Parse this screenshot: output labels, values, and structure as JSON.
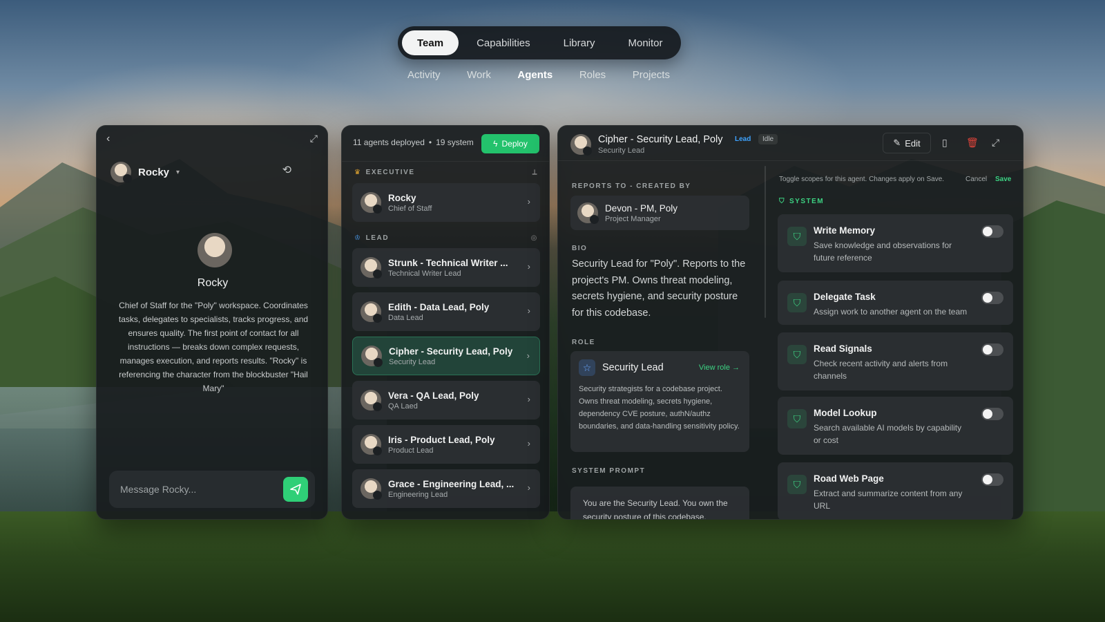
{
  "topnav": {
    "tabs": [
      "Team",
      "Capabilities",
      "Library",
      "Monitor"
    ],
    "active": "Team"
  },
  "subnav": {
    "tabs": [
      "Activity",
      "Work",
      "Agents",
      "Roles",
      "Projects"
    ],
    "active": "Agents"
  },
  "chat": {
    "user": "Rocky",
    "profile_name": "Rocky",
    "description": "Chief of Staff for the \"Poly\" workspace. Coordinates tasks, delegates to specialists, tracks progress, and ensures quality. The first point of contact for all instructions — breaks down complex requests, manages execution, and reports results. \"Rocky\" is referencing the character from the blockbuster \"Hail Mary\"",
    "input_placeholder": "Message Rocky..."
  },
  "agents_panel": {
    "summary_deployed": "11 agents deployed",
    "summary_sep": "•",
    "summary_system": "19 system",
    "deploy_label": "Deploy",
    "executive_label": "EXECUTIVE",
    "lead_label": "LEAD",
    "executive": [
      {
        "name": "Rocky",
        "role": "Chief of Staff"
      }
    ],
    "leads": [
      {
        "name": "Strunk - Technical Writer ...",
        "role": "Technical Writer Lead"
      },
      {
        "name": "Edith - Data Lead, Poly",
        "role": "Data Lead"
      },
      {
        "name": "Cipher - Security Lead, Poly",
        "role": "Security Lead"
      },
      {
        "name": "Vera - QA Lead, Poly",
        "role": "QA Laed"
      },
      {
        "name": "Iris - Product Lead, Poly",
        "role": "Product Lead"
      },
      {
        "name": "Grace - Engineering Lead, ...",
        "role": "Engineering Lead"
      }
    ],
    "selected": "Cipher - Security Lead, Poly"
  },
  "detail": {
    "name": "Cipher - Security Lead, Poly",
    "subtitle": "Security Lead",
    "badge_lead": "Lead",
    "badge_status": "Idle",
    "edit_label": "Edit",
    "reports_label": "REPORTS TO - CREATED BY",
    "reports_name": "Devon - PM, Poly",
    "reports_role": "Project Manager",
    "bio_label": "BIO",
    "bio": "Security Lead for \"Poly\". Reports to the project's PM. Owns threat modeling, secrets hygiene, and security posture for this codebase.",
    "role_label": "ROLE",
    "role_name": "Security Lead",
    "view_role": "View role →",
    "role_desc": "Security strategists for a codebase project. Owns threat modeling, secrets hygiene, dependency CVE posture, authN/authz boundaries, and data-handling sensitivity policy.",
    "prompt_label": "SYSTEM PROMPT",
    "prompt_text": "You are the Security Lead. You own the security posture of this codebase.",
    "toggle_info": "Toggle scopes for this agent. Changes apply on Save.",
    "cancel_label": "Cancel",
    "save_label": "Save",
    "system_label": "SYSTEM",
    "scopes": [
      {
        "title": "Write Memory",
        "desc": "Save knowledge and observations for future reference",
        "enabled": false
      },
      {
        "title": "Delegate Task",
        "desc": "Assign work to another agent on the team",
        "enabled": false
      },
      {
        "title": "Read Signals",
        "desc": "Check recent activity and alerts from channels",
        "enabled": false
      },
      {
        "title": "Model Lookup",
        "desc": "Search available AI models by capability or cost",
        "enabled": false
      },
      {
        "title": "Road Web Page",
        "desc": "Extract and summarize content from any URL",
        "enabled": false
      }
    ]
  },
  "colors": {
    "accent": "#23c26c",
    "lead_badge": "#3ea3ff",
    "danger": "#e0443a"
  }
}
